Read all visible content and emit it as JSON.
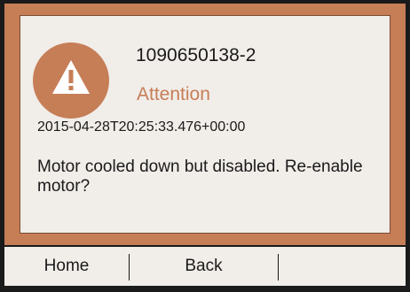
{
  "alert": {
    "id": "1090650138-2",
    "level": "Attention",
    "timestamp": "2015-04-28T20:25:33.476+00:00",
    "message": "Motor cooled down but disabled. Re-enable motor?",
    "icon": "warning-triangle-icon"
  },
  "footer": {
    "home_label": "Home",
    "back_label": "Back",
    "third_label": ""
  },
  "colors": {
    "accent": "#c67e57",
    "background": "#f1ede9",
    "text": "#1a1a1a"
  }
}
